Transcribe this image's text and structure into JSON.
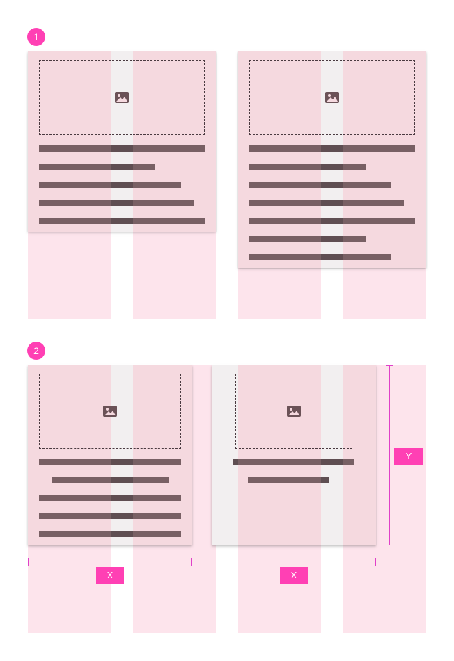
{
  "colors": {
    "accent": "#ff40b4",
    "column": "#fde4ec",
    "card": "#f5d9df",
    "gutter_on_card": "#f2eff0",
    "text_line": "#786064",
    "text_line_on_gutter": "#5f4e52",
    "measure": "#e040c8"
  },
  "sections": [
    {
      "badge": "1"
    },
    {
      "badge": "2"
    }
  ],
  "icons": {
    "image": "image-icon"
  },
  "measurements": {
    "width_label": "X",
    "height_label": "Y"
  }
}
